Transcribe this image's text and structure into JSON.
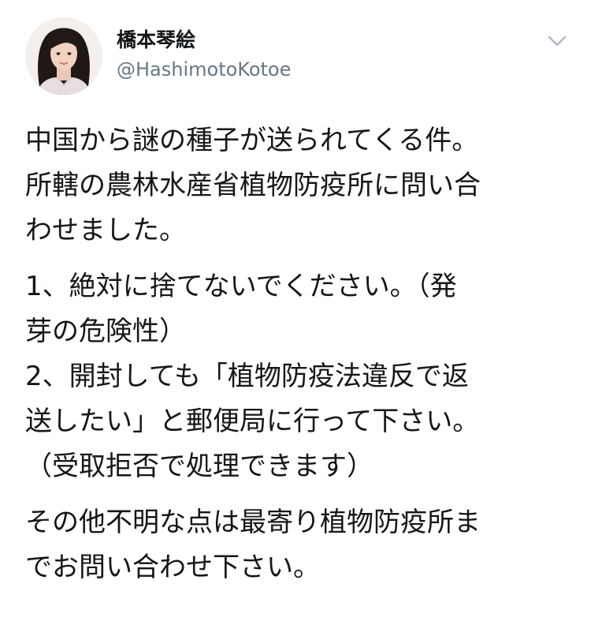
{
  "user": {
    "display_name": "橋本琴絵",
    "handle": "@HashimotoKotoe"
  },
  "menu": {
    "icon": "chevron-down-icon"
  },
  "tweet": {
    "paragraph1": [
      "中国から謎の種子が送られてくる件。",
      "所轄の農林水産省植物防疫所に問い合",
      "わせました。"
    ],
    "paragraph2": [
      "1、絶対に捨てないでください。（発",
      "芽の危険性）",
      "2、開封しても「植物防疫法違反で返",
      "送したい」と郵便局に行って下さい。",
      "（受取拒否で処理できます）"
    ],
    "paragraph3": [
      "その他不明な点は最寄り植物防疫所ま",
      "でお問い合わせ下さい。"
    ]
  },
  "colors": {
    "text": "#14171a",
    "secondary": "#657786",
    "caret": "#aab8c2"
  }
}
